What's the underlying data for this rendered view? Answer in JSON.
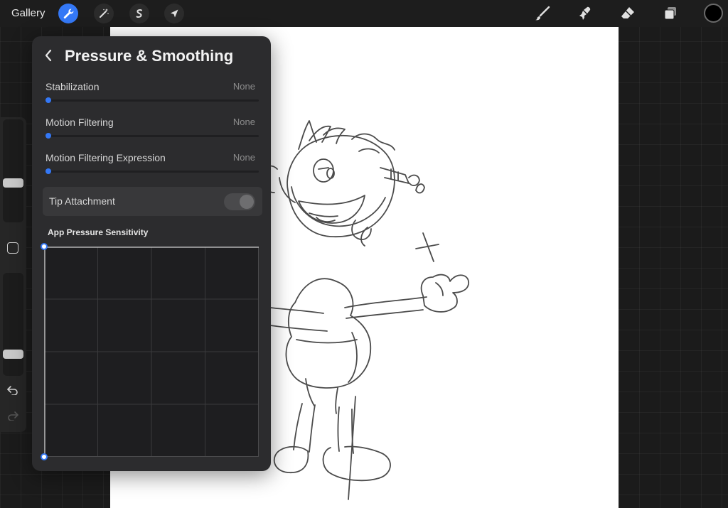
{
  "toolbar": {
    "gallery_label": "Gallery",
    "left_tools": [
      {
        "name": "wrench-icon",
        "active": true
      },
      {
        "name": "magic-wand-icon",
        "active": false
      },
      {
        "name": "selection-icon",
        "active": false
      },
      {
        "name": "transform-arrow-icon",
        "active": false
      }
    ],
    "right_tools": [
      "brush-icon",
      "smudge-icon",
      "eraser-icon",
      "layers-icon"
    ],
    "current_color": "#000000",
    "accent_color": "#3478f6"
  },
  "sidebar": {
    "brush_size_level": 0.37,
    "opacity_level": 0.18,
    "items": [
      "modify-button",
      "undo-icon",
      "redo-icon"
    ]
  },
  "panel": {
    "title": "Pressure & Smoothing",
    "settings": [
      {
        "label": "Stabilization",
        "value": "None",
        "level": 0
      },
      {
        "label": "Motion Filtering",
        "value": "None",
        "level": 0
      },
      {
        "label": "Motion Filtering Expression",
        "value": "None",
        "level": 0
      }
    ],
    "tip_attachment": {
      "label": "Tip Attachment",
      "enabled": false
    },
    "pressure_graph": {
      "label": "App Pressure Sensitivity"
    }
  }
}
